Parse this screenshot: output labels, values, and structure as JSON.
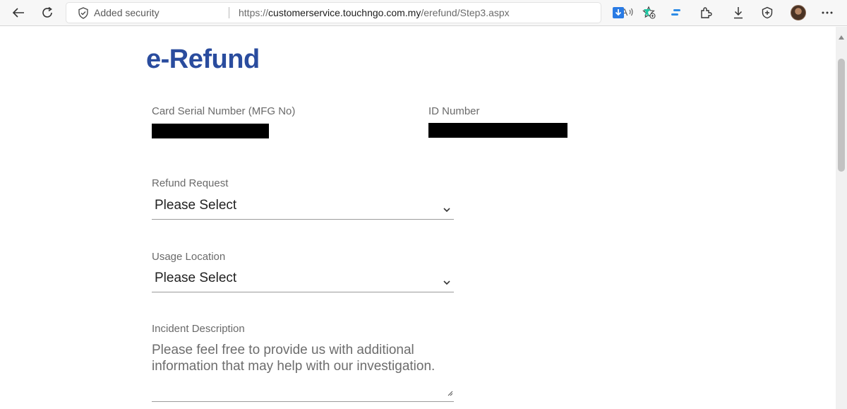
{
  "browser": {
    "address": {
      "security_label": "Added security",
      "url_prefix": "https://",
      "url_host": "customerservice.touchngo.com.my",
      "url_path": "/erefund/Step3.aspx"
    },
    "read_aloud_glyph": "A³⁾",
    "icons": [
      "back-icon",
      "refresh-icon",
      "shield-icon",
      "read-aloud-icon",
      "favorite-add-icon",
      "extension-download-icon",
      "extension-green-icon",
      "extension-blue-icon",
      "extensions-puzzle-icon",
      "downloads-icon",
      "browser-essentials-icon",
      "profile-avatar",
      "more-menu-icon"
    ]
  },
  "page": {
    "title": "e-Refund",
    "card_serial_label": "Card Serial Number (MFG No)",
    "id_number_label": "ID Number",
    "refund_request": {
      "label": "Refund Request",
      "selected": "Please Select"
    },
    "usage_location": {
      "label": "Usage Location",
      "selected": "Please Select"
    },
    "incident_description": {
      "label": "Incident Description",
      "placeholder": "Please feel free to provide us with additional information that may help with our investigation."
    }
  },
  "colors": {
    "title": "#2a4c9e",
    "label": "#6a6a6a",
    "redaction": "#000000"
  }
}
